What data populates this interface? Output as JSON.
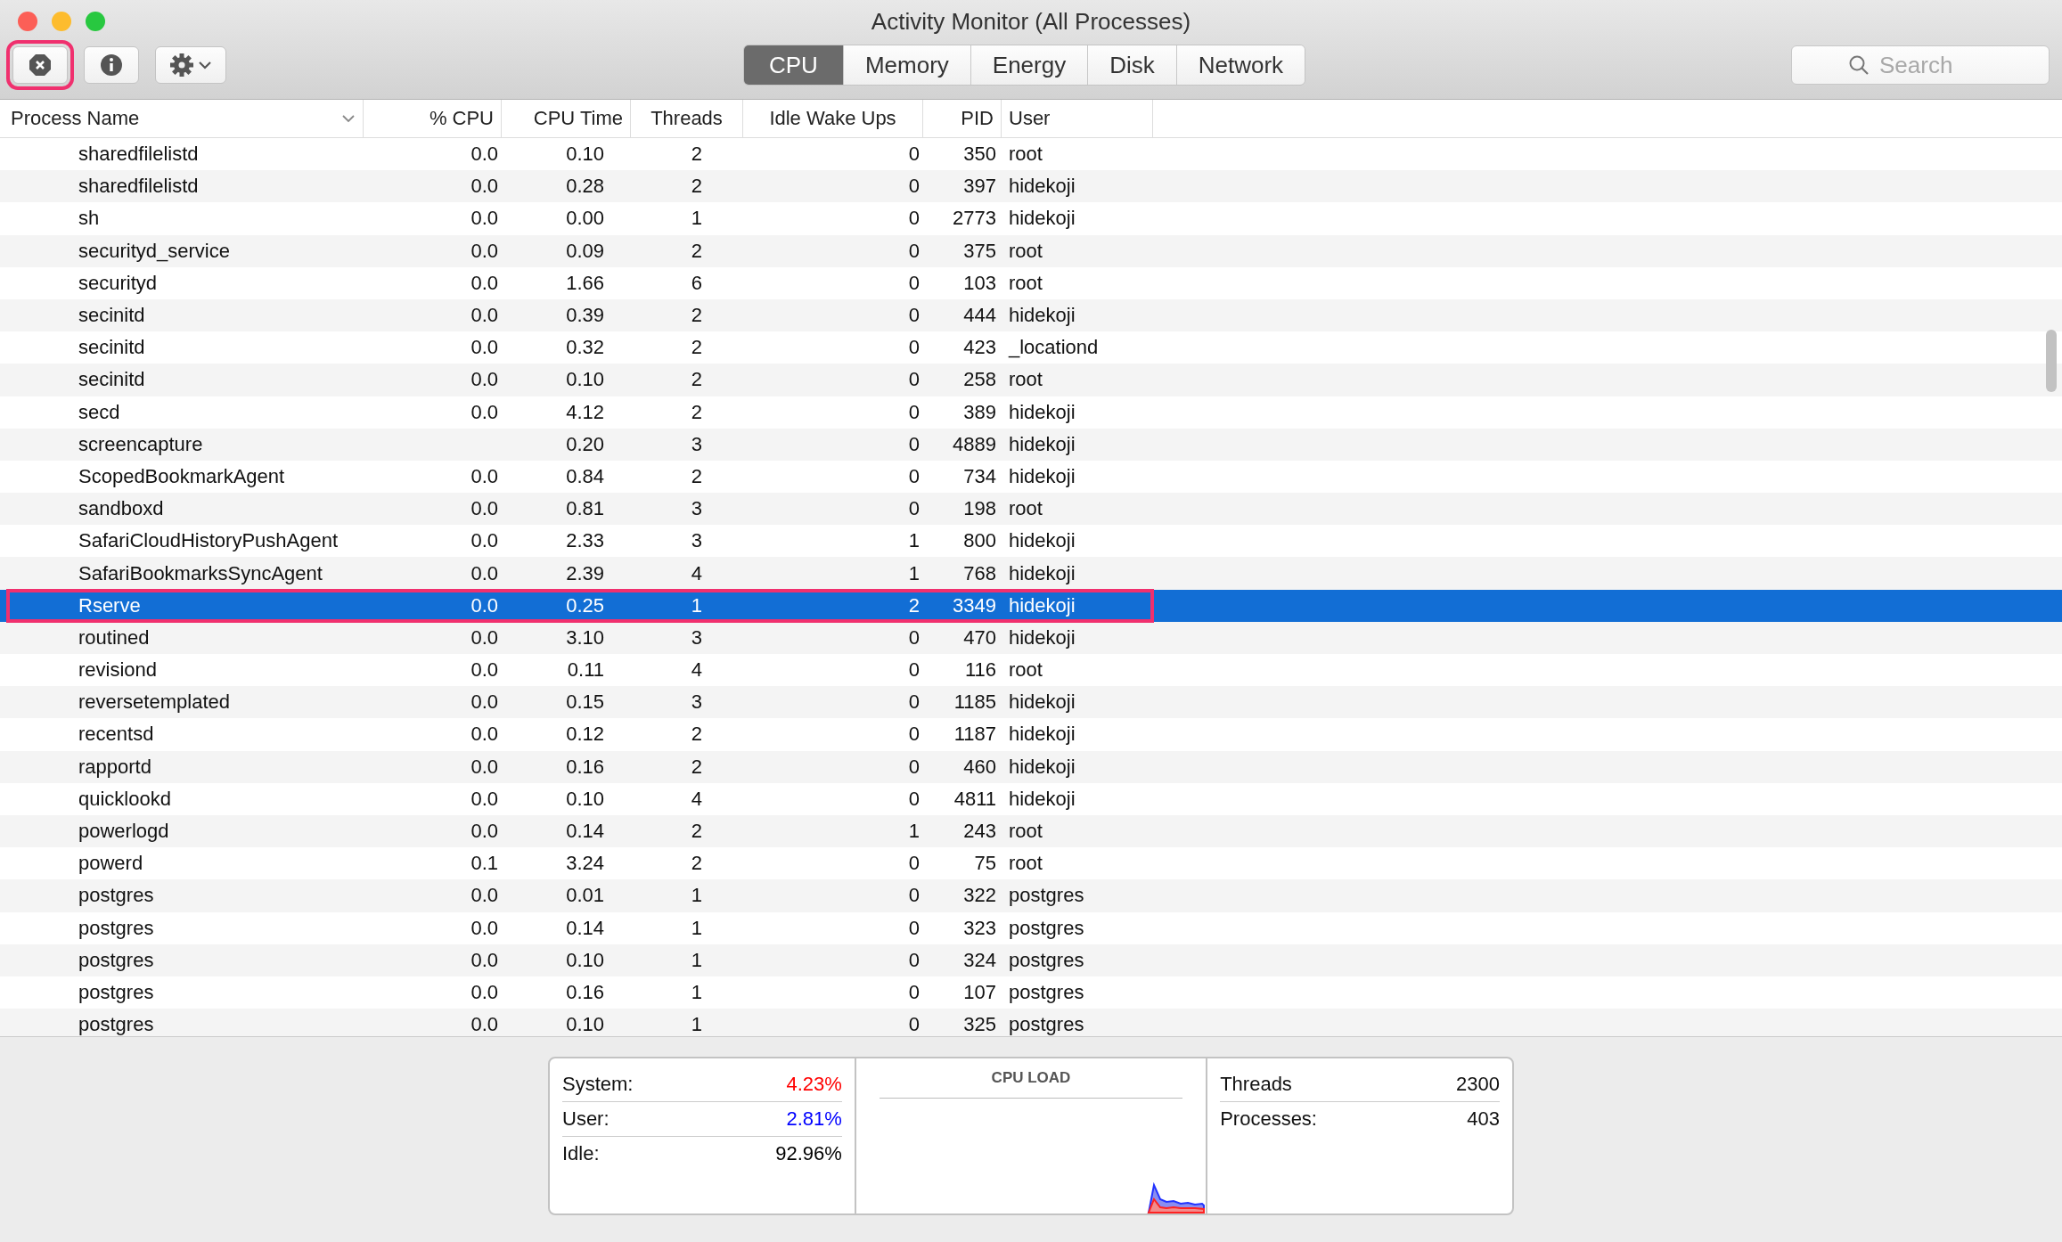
{
  "window": {
    "title": "Activity Monitor (All Processes)"
  },
  "toolbar": {
    "buttons": [
      {
        "kind": "stop",
        "annotated": true
      },
      {
        "kind": "info",
        "annotated": false
      },
      {
        "kind": "gear",
        "annotated": false
      }
    ]
  },
  "tabs": [
    {
      "label": "CPU",
      "selected": true
    },
    {
      "label": "Memory",
      "selected": false
    },
    {
      "label": "Energy",
      "selected": false
    },
    {
      "label": "Disk",
      "selected": false
    },
    {
      "label": "Network",
      "selected": false
    }
  ],
  "search": {
    "placeholder": "Search"
  },
  "table": {
    "columns": [
      "Process Name",
      "% CPU",
      "CPU Time",
      "Threads",
      "Idle Wake Ups",
      "PID",
      "User"
    ],
    "rows": [
      {
        "cells": [
          "sharedfilelistd",
          "0.0",
          "0.10",
          "2",
          "0",
          "350",
          "root"
        ],
        "selected": false,
        "annotated": false
      },
      {
        "cells": [
          "sharedfilelistd",
          "0.0",
          "0.28",
          "2",
          "0",
          "397",
          "hidekoji"
        ],
        "selected": false,
        "annotated": false
      },
      {
        "cells": [
          "sh",
          "0.0",
          "0.00",
          "1",
          "0",
          "2773",
          "hidekoji"
        ],
        "selected": false,
        "annotated": false
      },
      {
        "cells": [
          "securityd_service",
          "0.0",
          "0.09",
          "2",
          "0",
          "375",
          "root"
        ],
        "selected": false,
        "annotated": false
      },
      {
        "cells": [
          "securityd",
          "0.0",
          "1.66",
          "6",
          "0",
          "103",
          "root"
        ],
        "selected": false,
        "annotated": false
      },
      {
        "cells": [
          "secinitd",
          "0.0",
          "0.39",
          "2",
          "0",
          "444",
          "hidekoji"
        ],
        "selected": false,
        "annotated": false
      },
      {
        "cells": [
          "secinitd",
          "0.0",
          "0.32",
          "2",
          "0",
          "423",
          "_locationd"
        ],
        "selected": false,
        "annotated": false
      },
      {
        "cells": [
          "secinitd",
          "0.0",
          "0.10",
          "2",
          "0",
          "258",
          "root"
        ],
        "selected": false,
        "annotated": false
      },
      {
        "cells": [
          "secd",
          "0.0",
          "4.12",
          "2",
          "0",
          "389",
          "hidekoji"
        ],
        "selected": false,
        "annotated": false
      },
      {
        "cells": [
          "screencapture",
          null,
          "0.20",
          "3",
          "0",
          "4889",
          "hidekoji"
        ],
        "selected": false,
        "annotated": false
      },
      {
        "cells": [
          "ScopedBookmarkAgent",
          "0.0",
          "0.84",
          "2",
          "0",
          "734",
          "hidekoji"
        ],
        "selected": false,
        "annotated": false
      },
      {
        "cells": [
          "sandboxd",
          "0.0",
          "0.81",
          "3",
          "0",
          "198",
          "root"
        ],
        "selected": false,
        "annotated": false
      },
      {
        "cells": [
          "SafariCloudHistoryPushAgent",
          "0.0",
          "2.33",
          "3",
          "1",
          "800",
          "hidekoji"
        ],
        "selected": false,
        "annotated": false
      },
      {
        "cells": [
          "SafariBookmarksSyncAgent",
          "0.0",
          "2.39",
          "4",
          "1",
          "768",
          "hidekoji"
        ],
        "selected": false,
        "annotated": false
      },
      {
        "cells": [
          "Rserve",
          "0.0",
          "0.25",
          "1",
          "2",
          "3349",
          "hidekoji"
        ],
        "selected": true,
        "annotated": true
      },
      {
        "cells": [
          "routined",
          "0.0",
          "3.10",
          "3",
          "0",
          "470",
          "hidekoji"
        ],
        "selected": false,
        "annotated": false
      },
      {
        "cells": [
          "revisiond",
          "0.0",
          "0.11",
          "4",
          "0",
          "116",
          "root"
        ],
        "selected": false,
        "annotated": false
      },
      {
        "cells": [
          "reversetemplated",
          "0.0",
          "0.15",
          "3",
          "0",
          "1185",
          "hidekoji"
        ],
        "selected": false,
        "annotated": false
      },
      {
        "cells": [
          "recentsd",
          "0.0",
          "0.12",
          "2",
          "0",
          "1187",
          "hidekoji"
        ],
        "selected": false,
        "annotated": false
      },
      {
        "cells": [
          "rapportd",
          "0.0",
          "0.16",
          "2",
          "0",
          "460",
          "hidekoji"
        ],
        "selected": false,
        "annotated": false
      },
      {
        "cells": [
          "quicklookd",
          "0.0",
          "0.10",
          "4",
          "0",
          "4811",
          "hidekoji"
        ],
        "selected": false,
        "annotated": false
      },
      {
        "cells": [
          "powerlogd",
          "0.0",
          "0.14",
          "2",
          "1",
          "243",
          "root"
        ],
        "selected": false,
        "annotated": false
      },
      {
        "cells": [
          "powerd",
          "0.1",
          "3.24",
          "2",
          "0",
          "75",
          "root"
        ],
        "selected": false,
        "annotated": false
      },
      {
        "cells": [
          "postgres",
          "0.0",
          "0.01",
          "1",
          "0",
          "322",
          "postgres"
        ],
        "selected": false,
        "annotated": false
      },
      {
        "cells": [
          "postgres",
          "0.0",
          "0.14",
          "1",
          "0",
          "323",
          "postgres"
        ],
        "selected": false,
        "annotated": false
      },
      {
        "cells": [
          "postgres",
          "0.0",
          "0.10",
          "1",
          "0",
          "324",
          "postgres"
        ],
        "selected": false,
        "annotated": false
      },
      {
        "cells": [
          "postgres",
          "0.0",
          "0.16",
          "1",
          "0",
          "107",
          "postgres"
        ],
        "selected": false,
        "annotated": false
      },
      {
        "cells": [
          "postgres",
          "0.0",
          "0.10",
          "1",
          "0",
          "325",
          "postgres"
        ],
        "selected": false,
        "annotated": false
      }
    ]
  },
  "summary": {
    "stats": [
      {
        "label": "System:",
        "value": "4.23%",
        "color": "#ff0000"
      },
      {
        "label": "User:",
        "value": "2.81%",
        "color": "#0000ff"
      },
      {
        "label": "Idle:",
        "value": "92.96%",
        "color": "#000000"
      }
    ],
    "chart_title": "CPU LOAD",
    "counts": [
      {
        "label": "Threads",
        "value": "2300"
      },
      {
        "label": "Processes:",
        "value": "403"
      }
    ]
  }
}
